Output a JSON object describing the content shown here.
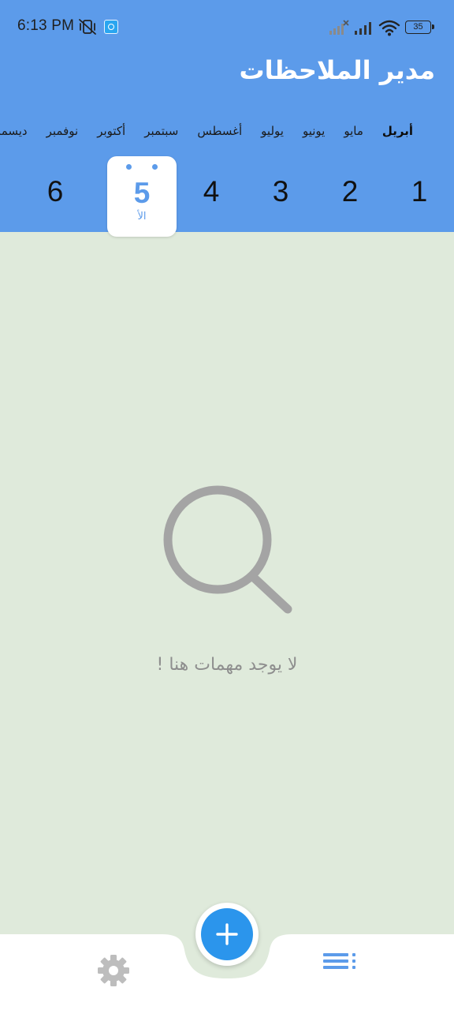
{
  "status_bar": {
    "time": "6:13 PM",
    "battery": "35"
  },
  "app": {
    "title": "مدير الملاحظات"
  },
  "months": [
    {
      "label": "أبريل",
      "active": true
    },
    {
      "label": "مايو",
      "active": false
    },
    {
      "label": "يونيو",
      "active": false
    },
    {
      "label": "يوليو",
      "active": false
    },
    {
      "label": "أغسطس",
      "active": false
    },
    {
      "label": "سبتمبر",
      "active": false
    },
    {
      "label": "أكتوبر",
      "active": false
    },
    {
      "label": "نوفمبر",
      "active": false
    },
    {
      "label": "ديسمبر",
      "active": false
    }
  ],
  "days": [
    {
      "num": "1",
      "selected": false
    },
    {
      "num": "2",
      "selected": false
    },
    {
      "num": "3",
      "selected": false
    },
    {
      "num": "4",
      "selected": false
    },
    {
      "num": "5",
      "selected": true,
      "weekday": "الأ"
    },
    {
      "num": "6",
      "selected": false
    }
  ],
  "empty_state": {
    "icon": "search-icon",
    "message": "لا يوجد مهمات هنا !"
  },
  "bottom_nav": {
    "left_icon": "settings-icon",
    "center_icon": "add-icon",
    "right_icon": "list-icon"
  },
  "colors": {
    "header": "#5c9bea",
    "background": "#dfeadb",
    "fab": "#2b95ec",
    "muted_text": "#8e8e8e"
  }
}
